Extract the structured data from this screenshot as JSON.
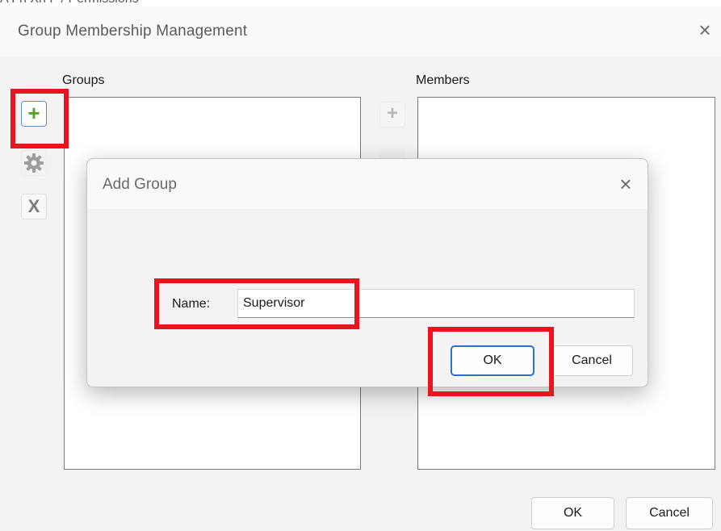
{
  "window": {
    "top_strip_text": "A  Fn Xn F / Permissions",
    "title": "Group Membership Management",
    "close_glyph": "×"
  },
  "groups": {
    "label": "Groups"
  },
  "members": {
    "label": "Members"
  },
  "toolbar": {
    "add_glyph": "+",
    "edit_icon": "gear-icon",
    "delete_glyph": "X",
    "add_member_glyph": "+"
  },
  "buttons": {
    "ok": "OK",
    "cancel": "Cancel"
  },
  "dialog": {
    "title": "Add Group",
    "close_glyph": "×",
    "name_label": "Name:",
    "name_value": "Supervisor",
    "ok": "OK",
    "cancel": "Cancel"
  },
  "colors": {
    "highlight": "#e8141e",
    "add_icon": "#58a32b",
    "focus_border": "#2f6fcc"
  }
}
